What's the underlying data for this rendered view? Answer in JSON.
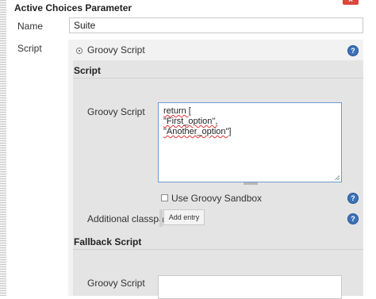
{
  "header": {
    "title": "Active Choices Parameter",
    "close_label": "x"
  },
  "name_field": {
    "label": "Name",
    "value": "Suite"
  },
  "script_field": {
    "label": "Script",
    "option_label": "Groovy Script"
  },
  "script_section": {
    "heading": "Script",
    "groovy_label": "Groovy Script",
    "code_lines": [
      "return [",
      "\"First_option\",",
      "\"Another_option\"]"
    ],
    "sandbox_label": "Use Groovy Sandbox",
    "classpath_label": "Additional classpath",
    "add_entry_label": "Add entry"
  },
  "fallback_section": {
    "heading": "Fallback Script",
    "groovy_label": "Groovy Script"
  },
  "help_label": "?",
  "colors": {
    "help_icon": "#3b73b9",
    "close_button": "#d9463a",
    "focus_border": "#6b9bd4"
  }
}
